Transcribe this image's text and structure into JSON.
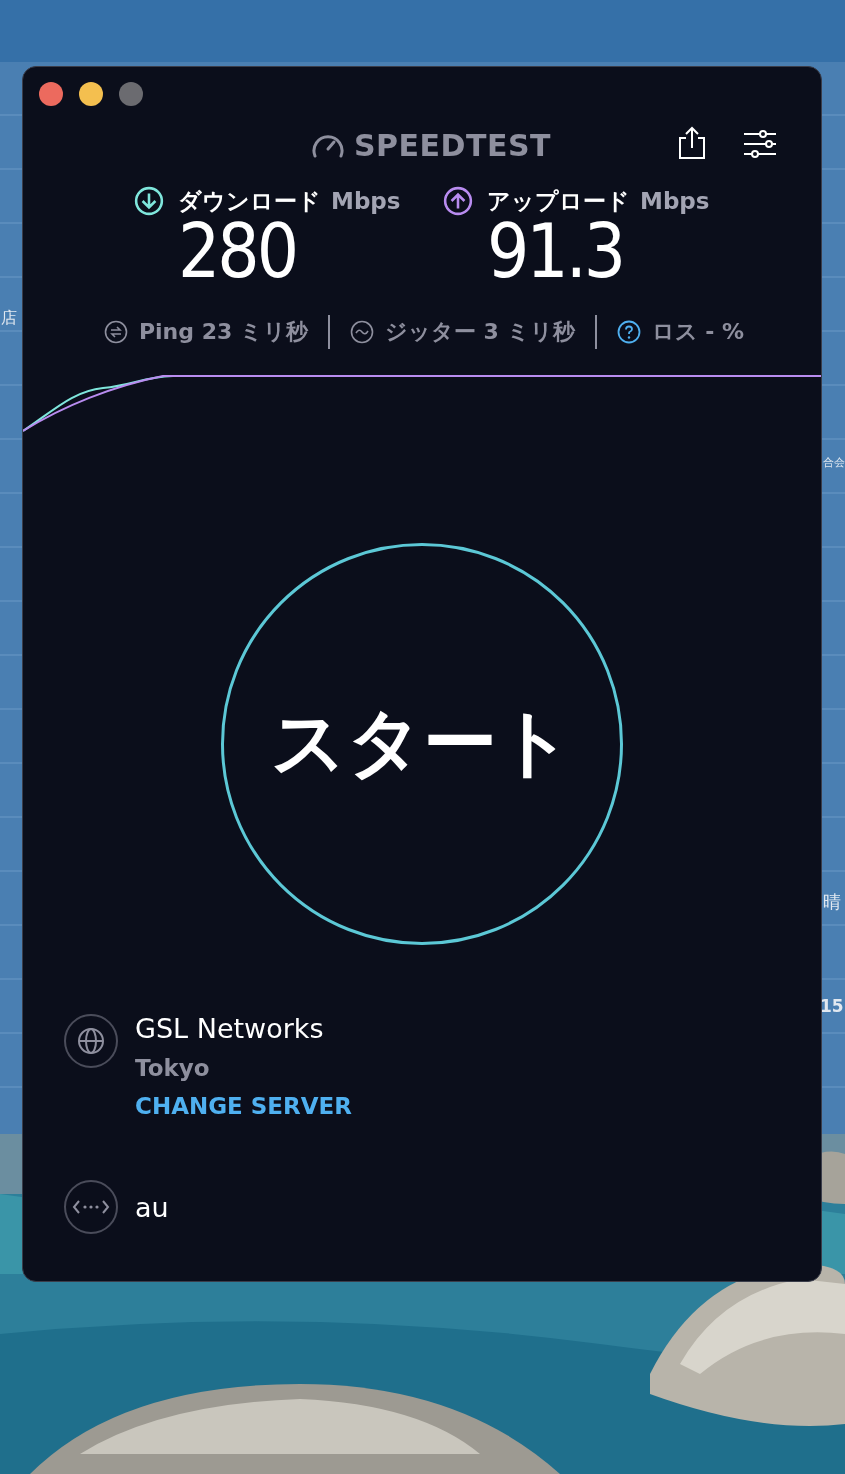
{
  "background_fragments": [
    {
      "text": "店"
    },
    {
      "text": "合会"
    },
    {
      "text": "晴"
    },
    {
      "text": "15"
    }
  ],
  "app": {
    "logo": "SPEEDTEST"
  },
  "results": [
    {
      "kind": "download",
      "label": "ダウンロード",
      "unit": "Mbps",
      "value": "280"
    },
    {
      "kind": "upload",
      "label": "アップロード",
      "unit": "Mbps",
      "value": "91.3"
    }
  ],
  "metrics": [
    {
      "kind": "ping",
      "text": "Ping 23 ミリ秒"
    },
    {
      "kind": "jitter",
      "text": "ジッター 3 ミリ秒"
    },
    {
      "kind": "loss",
      "text": "ロス - %"
    }
  ],
  "start_button": {
    "label": "スタート"
  },
  "server": {
    "name": "GSL Networks",
    "location": "Tokyo",
    "action": "CHANGE SERVER"
  },
  "provider": {
    "name": "au"
  }
}
